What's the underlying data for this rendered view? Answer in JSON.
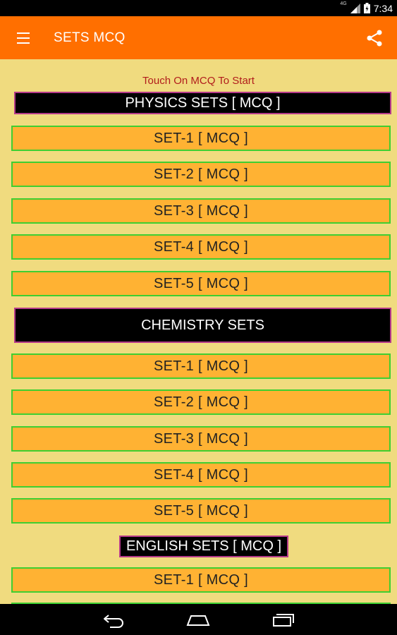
{
  "status_bar": {
    "time": "7:34",
    "network_label": "4G"
  },
  "app_bar": {
    "title": "SETS MCQ"
  },
  "hint_text": "Touch On MCQ To Start",
  "sections": [
    {
      "header": "PHYSICS SETS [ MCQ ]",
      "sets": [
        "SET-1 [ MCQ ]",
        "SET-2 [ MCQ ]",
        "SET-3 [ MCQ ]",
        "SET-4 [ MCQ ]",
        "SET-5 [ MCQ ]"
      ]
    },
    {
      "header": "CHEMISTRY SETS",
      "sets": [
        "SET-1 [ MCQ ]",
        "SET-2 [ MCQ ]",
        "SET-3 [ MCQ ]",
        "SET-4 [ MCQ ]",
        "SET-5 [ MCQ ]"
      ]
    },
    {
      "header": "ENGLISH SETS [ MCQ ]",
      "sets": [
        "SET-1 [ MCQ ]"
      ]
    }
  ],
  "colors": {
    "app_bar": "#ff6f00",
    "background": "#f0db7f",
    "set_button": "#ffb233",
    "set_border": "#3ecf31",
    "header_bg": "#000000",
    "header_border": "#b53a8a",
    "hint": "#b11c1c"
  },
  "icons": {
    "menu": "hamburger-menu-icon",
    "share": "share-icon",
    "back": "back-icon",
    "home": "home-icon",
    "recents": "recents-icon"
  }
}
